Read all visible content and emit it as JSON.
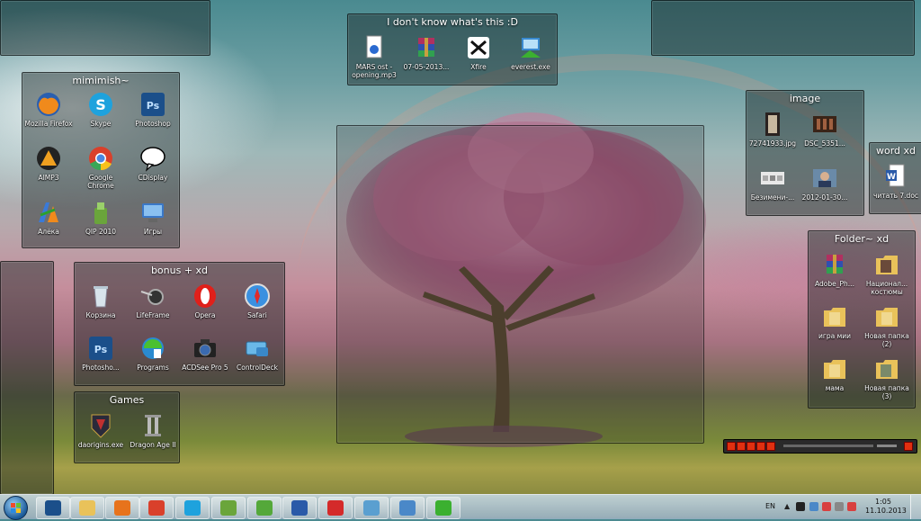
{
  "fences": {
    "mimimish": {
      "title": "mimimish~",
      "items": [
        {
          "label": "Mozilla Firefox",
          "icon": "firefox-icon"
        },
        {
          "label": "Skype",
          "icon": "skype-icon"
        },
        {
          "label": "Photoshop",
          "icon": "photoshop-icon"
        },
        {
          "label": "AIMP3",
          "icon": "aimp-icon"
        },
        {
          "label": "Google Chrome",
          "icon": "chrome-icon"
        },
        {
          "label": "CDisplay",
          "icon": "speech-bubble-icon"
        },
        {
          "label": "Алёка",
          "icon": "aleka-icon"
        },
        {
          "label": "QIP 2010",
          "icon": "qip-icon"
        },
        {
          "label": "Игры",
          "icon": "games-folder-icon"
        }
      ]
    },
    "unknown": {
      "title": "I don't know what's this :D",
      "items": [
        {
          "label": "MARS ost - opening.mp3",
          "icon": "audio-file-icon"
        },
        {
          "label": "07-05-2013...",
          "icon": "winrar-icon"
        },
        {
          "label": "Xfire",
          "icon": "xfire-icon"
        },
        {
          "label": "everest.exe",
          "icon": "everest-icon"
        }
      ]
    },
    "image": {
      "title": "image",
      "items": [
        {
          "label": "72741933.jpg",
          "icon": "image-thumbnail-icon"
        },
        {
          "label": "DSC_5351...",
          "icon": "image-thumbnail-icon"
        },
        {
          "label": "Безимени-...",
          "icon": "image-thumbnail-icon"
        },
        {
          "label": "2012-01-30...",
          "icon": "image-thumbnail-icon"
        }
      ]
    },
    "word": {
      "title": "word xd",
      "items": [
        {
          "label": "читать 7.doc",
          "icon": "word-doc-icon"
        }
      ]
    },
    "folder": {
      "title": "Folder~ xd",
      "items": [
        {
          "label": "Adobe_Ph...",
          "icon": "winrar-icon"
        },
        {
          "label": "Национал... костюмы",
          "icon": "folder-icon"
        },
        {
          "label": "игра мии",
          "icon": "folder-icon"
        },
        {
          "label": "Новая папка (2)",
          "icon": "folder-icon"
        },
        {
          "label": "мама",
          "icon": "folder-icon"
        },
        {
          "label": "Новая папка (3)",
          "icon": "folder-icon"
        }
      ]
    },
    "bonus": {
      "title": "bonus + xd",
      "items": [
        {
          "label": "Корзина",
          "icon": "recycle-bin-icon"
        },
        {
          "label": "LifeFrame",
          "icon": "lifeframe-icon"
        },
        {
          "label": "Opera",
          "icon": "opera-icon"
        },
        {
          "label": "Safari",
          "icon": "safari-icon"
        },
        {
          "label": "Photosho...",
          "icon": "photoshop-icon"
        },
        {
          "label": "Programs",
          "icon": "programs-icon"
        },
        {
          "label": "ACDSee Pro 5",
          "icon": "acdsee-icon"
        },
        {
          "label": "ControlDeck",
          "icon": "controldeck-icon"
        }
      ]
    },
    "games": {
      "title": "Games",
      "items": [
        {
          "label": "daorigins.exe",
          "icon": "dragon-age-icon"
        },
        {
          "label": "Dragon Age II",
          "icon": "dragon-age-2-icon"
        }
      ]
    }
  },
  "taskbar": {
    "apps": [
      {
        "name": "photoshop",
        "icon": "photoshop-icon",
        "color": "#1b4f8a"
      },
      {
        "name": "explorer",
        "icon": "folder-icon",
        "color": "#e9c25a"
      },
      {
        "name": "firefox",
        "icon": "firefox-icon",
        "color": "#e7731c"
      },
      {
        "name": "chrome",
        "icon": "chrome-icon",
        "color": "#d9402b"
      },
      {
        "name": "skype",
        "icon": "skype-icon",
        "color": "#1ea2dd"
      },
      {
        "name": "qip",
        "icon": "qip-icon",
        "color": "#6aa53b"
      },
      {
        "name": "utorrent",
        "icon": "utorrent-icon",
        "color": "#54a83a"
      },
      {
        "name": "word",
        "icon": "word-icon",
        "color": "#2a5aa8"
      },
      {
        "name": "daemon",
        "icon": "daemon-tools-icon",
        "color": "#d42a2a"
      },
      {
        "name": "app-blue",
        "icon": "generic-app-icon",
        "color": "#5a9fd0"
      },
      {
        "name": "app-screen",
        "icon": "display-icon",
        "color": "#4a88c8"
      },
      {
        "name": "everest",
        "icon": "everest-icon",
        "color": "#3bb030"
      }
    ],
    "language": "EN",
    "time": "1:05",
    "date": "11.10.2013"
  }
}
